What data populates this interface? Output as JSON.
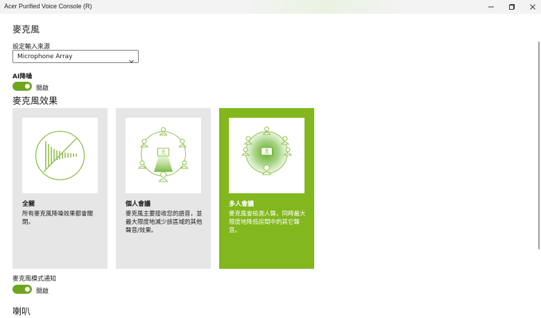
{
  "window": {
    "title": "Acer Purified Voice Console (R)",
    "minimize_icon": "minimize-icon",
    "maximize_icon": "maximize-icon",
    "close_icon": "close-icon"
  },
  "microphone": {
    "heading": "麥克風",
    "input_source": {
      "label": "設定輸入來源",
      "selected": "Microphone Array"
    },
    "ai_noise": {
      "label": "AI降噪",
      "state_label": "開啟",
      "on": true
    },
    "effects": {
      "heading": "麥克風效果",
      "cards": [
        {
          "title": "全關",
          "description": "所有麥克風降噪效果都會關閉。",
          "selected": false
        },
        {
          "title": "個人會議",
          "description": "麥克風主要接收您的語音，並最大限度地減少該區域的其他聲音/效果。",
          "selected": false
        },
        {
          "title": "多人會議",
          "description": "麥克風會檢測人聲，同時最大限度地降低房間中的其它聲音。",
          "selected": true
        }
      ]
    },
    "mode_notify": {
      "label": "麥克風模式通知",
      "state_label": "開啟",
      "on": true
    }
  },
  "speaker": {
    "heading": "喇叭"
  },
  "colors": {
    "accent": "#82b71e",
    "toggle_on": "#6ea51f",
    "card_bg": "#e6e6e6"
  }
}
